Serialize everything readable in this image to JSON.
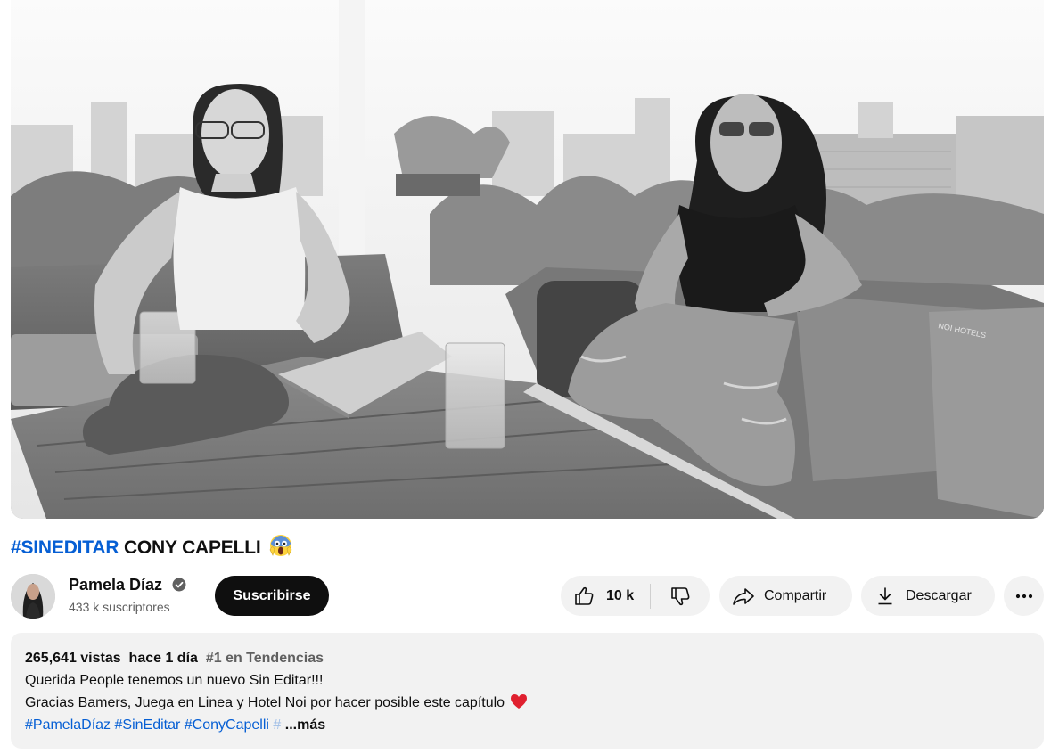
{
  "video": {
    "title_hashtag": "#SINEDITAR",
    "title_rest": "CONY CAPELLI",
    "title_emoji": "screaming-face-emoji",
    "thumbnail_sign": "NOI HOTELS"
  },
  "channel": {
    "name": "Pamela Díaz",
    "verified": true,
    "subscribers": "433 k suscriptores"
  },
  "actions": {
    "subscribe_label": "Suscribirse",
    "like_count": "10 k",
    "share_label": "Compartir",
    "download_label": "Descargar"
  },
  "description": {
    "views": "265,641 vistas",
    "age": "hace 1 día",
    "trending": "#1 en Tendencias",
    "line1": "Querida People tenemos un nuevo Sin Editar!!!",
    "line2": "Gracias Bamers, Juega en Linea y Hotel Noi por hacer posible este capítulo",
    "hashtag1": "#PamelaDíaz",
    "hashtag2": "#SinEditar",
    "hashtag3": "#ConyCapelli",
    "hashtag_fade": "#",
    "more_label": "...más"
  },
  "colors": {
    "link": "#065fd4",
    "button_bg": "#f2f2f2",
    "subscribe_bg": "#0f0f0f",
    "heart": "#e0202f"
  }
}
